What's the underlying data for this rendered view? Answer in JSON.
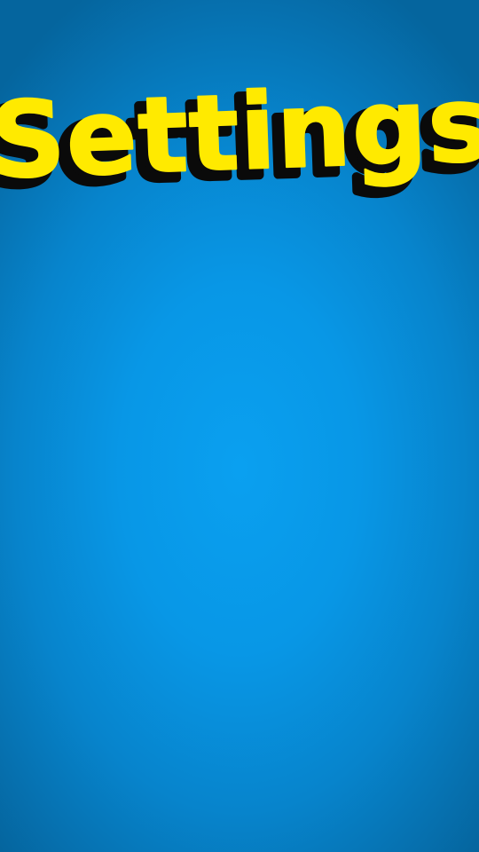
{
  "screen": {
    "title": "Settings",
    "colors": {
      "background_center": "#0aa0f0",
      "background_edge": "#05659e",
      "title_fill": "#ffea00",
      "title_shadow": "#0a0a0a"
    }
  }
}
